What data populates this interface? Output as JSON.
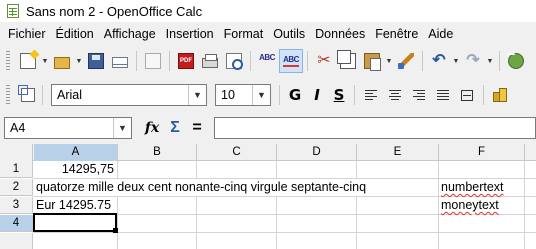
{
  "window": {
    "title": "Sans nom 2 - OpenOffice Calc"
  },
  "menu": {
    "items": [
      "Fichier",
      "Édition",
      "Affichage",
      "Insertion",
      "Format",
      "Outils",
      "Données",
      "Fenêtre",
      "Aide"
    ]
  },
  "format_toolbar": {
    "font_name": "Arial",
    "font_size": "10",
    "bold_glyph": "G",
    "italic_glyph": "I",
    "underline_glyph": "S"
  },
  "formula_bar": {
    "cell_reference": "A4",
    "fx_glyph": "fx",
    "sum_glyph": "Σ",
    "equals_glyph": "=",
    "content": ""
  },
  "sheet": {
    "columns": [
      "A",
      "B",
      "C",
      "D",
      "E",
      "F"
    ],
    "rows": [
      "1",
      "2",
      "3",
      "4"
    ],
    "selected_cell": "A4",
    "cells": {
      "A1": "14295,75",
      "A2": "quatorze mille deux cent nonante-cinq virgule septante-cinq",
      "A3": "Eur 14295.75",
      "F2": "numbertext",
      "F3": "moneytext"
    }
  },
  "colors": {
    "selection_header": "#b9d0e9",
    "spell_error": "#d33"
  }
}
